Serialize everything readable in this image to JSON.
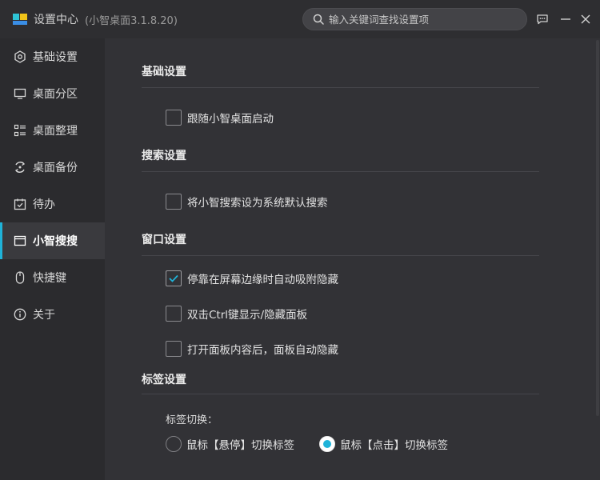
{
  "app": {
    "title": "设置中心",
    "version": "(小智桌面3.1.8.20)"
  },
  "search": {
    "placeholder": "输入关键词查找设置项"
  },
  "sidebar": {
    "items": [
      {
        "label": "基础设置",
        "icon": "gear-icon",
        "active": false
      },
      {
        "label": "桌面分区",
        "icon": "monitor-icon",
        "active": false
      },
      {
        "label": "桌面整理",
        "icon": "list-icon",
        "active": false
      },
      {
        "label": "桌面备份",
        "icon": "backup-icon",
        "active": false
      },
      {
        "label": "待办",
        "icon": "calendar-check-icon",
        "active": false
      },
      {
        "label": "小智搜搜",
        "icon": "window-icon",
        "active": true
      },
      {
        "label": "快捷键",
        "icon": "mouse-icon",
        "active": false
      },
      {
        "label": "关于",
        "icon": "info-icon",
        "active": false
      }
    ]
  },
  "sections": {
    "basic": {
      "title": "基础设置",
      "options": [
        {
          "label": "跟随小智桌面启动",
          "checked": false
        }
      ]
    },
    "search": {
      "title": "搜索设置",
      "options": [
        {
          "label": "将小智搜索设为系统默认搜索",
          "checked": false
        }
      ]
    },
    "window": {
      "title": "窗口设置",
      "options": [
        {
          "label": "停靠在屏幕边缘时自动吸附隐藏",
          "checked": true
        },
        {
          "label": "双击Ctrl键显示/隐藏面板",
          "checked": false
        },
        {
          "label": "打开面板内容后，面板自动隐藏",
          "checked": false
        }
      ]
    },
    "tabs": {
      "title": "标签设置",
      "switch_label": "标签切换：",
      "radios": [
        {
          "label": "鼠标【悬停】切换标签",
          "selected": false
        },
        {
          "label": "鼠标【点击】切换标签",
          "selected": true
        }
      ]
    }
  },
  "colors": {
    "accent": "#1fb3d9",
    "background": "#323236",
    "sidebar": "#2b2b2e"
  }
}
